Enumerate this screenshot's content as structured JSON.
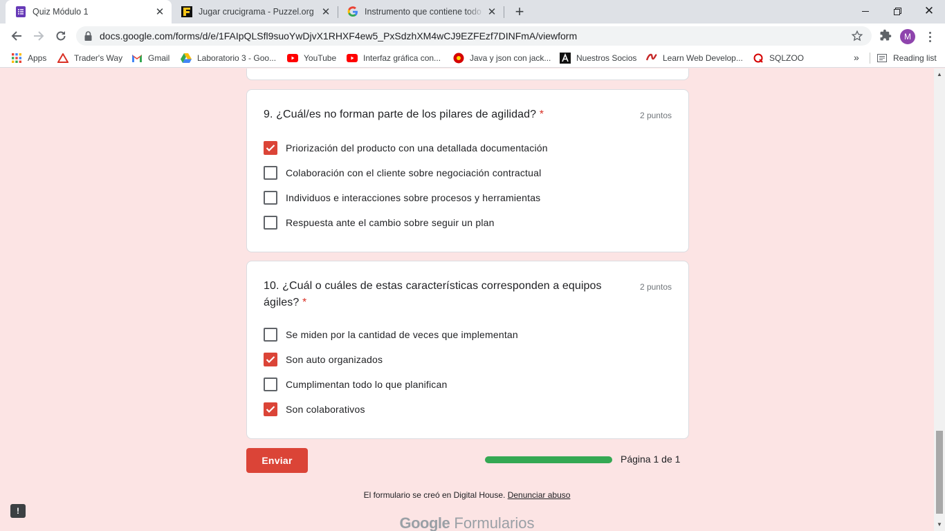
{
  "tabs": [
    {
      "title": "Quiz Módulo 1",
      "active": true
    },
    {
      "title": "Jugar crucigrama - Puzzel.org",
      "active": false
    },
    {
      "title": "Instrumento que contiene todo el",
      "active": false
    }
  ],
  "toolbar": {
    "url": "docs.google.com/forms/d/e/1FAIpQLSfl9suoYwDjvX1RHXF4ew5_PxSdzhXM4wCJ9EZFEzf7DINFmA/viewform",
    "avatar_letter": "M"
  },
  "bookmarks": [
    {
      "label": "Apps",
      "icon": "apps-grid-icon"
    },
    {
      "label": "Trader's Way",
      "icon": "traders-way-icon"
    },
    {
      "label": "Gmail",
      "icon": "gmail-icon"
    },
    {
      "label": "Laboratorio 3 - Goo...",
      "icon": "google-drive-icon"
    },
    {
      "label": "YouTube",
      "icon": "youtube-icon"
    },
    {
      "label": "Interfaz gráfica con...",
      "icon": "youtube-icon"
    },
    {
      "label": "Java y json con jack...",
      "icon": "java-site-icon"
    },
    {
      "label": "Nuestros Socios",
      "icon": "a-logo-icon"
    },
    {
      "label": "Learn Web Develop...",
      "icon": "web-dev-icon"
    },
    {
      "label": "SQLZOO",
      "icon": "sqlzoo-icon"
    }
  ],
  "bookmarks_more": "»",
  "reading_list": "Reading list",
  "questions": [
    {
      "title": "9. ¿Cuál/es no forman parte de los pilares de agilidad?",
      "required_mark": "*",
      "points": "2 puntos",
      "options": [
        {
          "label": "Priorización del producto con una detallada documentación",
          "checked": true
        },
        {
          "label": "Colaboración con el cliente sobre negociación contractual",
          "checked": false
        },
        {
          "label": "Individuos e interacciones sobre procesos y herramientas",
          "checked": false
        },
        {
          "label": "Respuesta ante el cambio sobre seguir un plan",
          "checked": false
        }
      ]
    },
    {
      "title_line1": "10. ¿Cuál o cuáles de estas características corresponden a equipos",
      "title_line2": "ágiles?",
      "required_mark": "*",
      "points": "2 puntos",
      "options": [
        {
          "label": "Se miden por la cantidad de veces que implementan",
          "checked": false
        },
        {
          "label": "Son auto organizados",
          "checked": true
        },
        {
          "label": "Cumplimentan todo lo que planifican",
          "checked": false
        },
        {
          "label": "Son colaborativos",
          "checked": true
        }
      ]
    }
  ],
  "submit_label": "Enviar",
  "progress_fraction": 1.0,
  "page_indicator": "Página 1 de 1",
  "footer": {
    "text": "El formulario se creó en Digital House.",
    "link": "Denunciar abuso"
  },
  "brand": {
    "google": "Google",
    "product": "Formularios"
  },
  "colors": {
    "accent": "#db4437",
    "progress": "#34a853",
    "background": "#fce4e4"
  }
}
